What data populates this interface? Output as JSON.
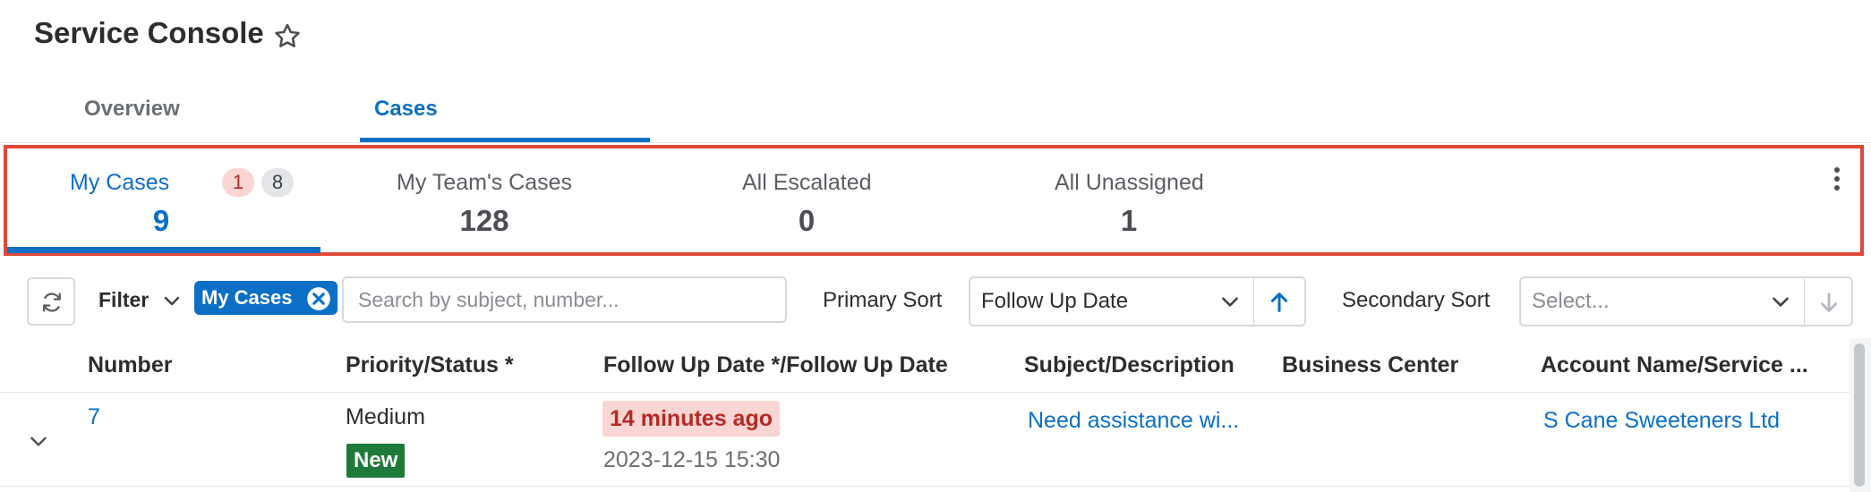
{
  "header": {
    "title": "Service Console",
    "star_icon": "star-outline-icon"
  },
  "tabs": [
    {
      "label": "Overview",
      "active": false
    },
    {
      "label": "Cases",
      "active": true
    }
  ],
  "dashlets": [
    {
      "label": "My Cases",
      "count": "9",
      "active": true,
      "badges": [
        "1",
        "8"
      ]
    },
    {
      "label": "My Team's Cases",
      "count": "128",
      "active": false
    },
    {
      "label": "All Escalated",
      "count": "0",
      "active": false
    },
    {
      "label": "All Unassigned",
      "count": "1",
      "active": false
    }
  ],
  "toolbar": {
    "refresh_icon": "refresh-icon",
    "filter_label": "Filter",
    "filter_pill": "My Cases",
    "search_placeholder": "Search by subject, number...",
    "primary_sort_label": "Primary Sort",
    "primary_sort_value": "Follow Up Date",
    "secondary_sort_label": "Secondary Sort",
    "secondary_sort_placeholder": "Select..."
  },
  "table": {
    "columns": [
      "Number",
      "Priority/Status *",
      "Follow Up Date */Follow Up Date",
      "Subject/Description",
      "Business Center",
      "Account Name/Service ..."
    ],
    "rows": [
      {
        "number": "7",
        "priority": "Medium",
        "status": "New",
        "follow_up_relative": "14 minutes ago",
        "follow_up_date": "2023-12-15 15:30",
        "subject": "Need assistance wi...",
        "business_center": "",
        "account": "S Cane Sweeteners Ltd"
      }
    ]
  },
  "colors": {
    "accent": "#0b6fc6",
    "highlight_box": "#e2473a",
    "status_new": "#1f7a3a",
    "overdue_bg": "#f9d5d4",
    "overdue_text": "#b52a25"
  }
}
